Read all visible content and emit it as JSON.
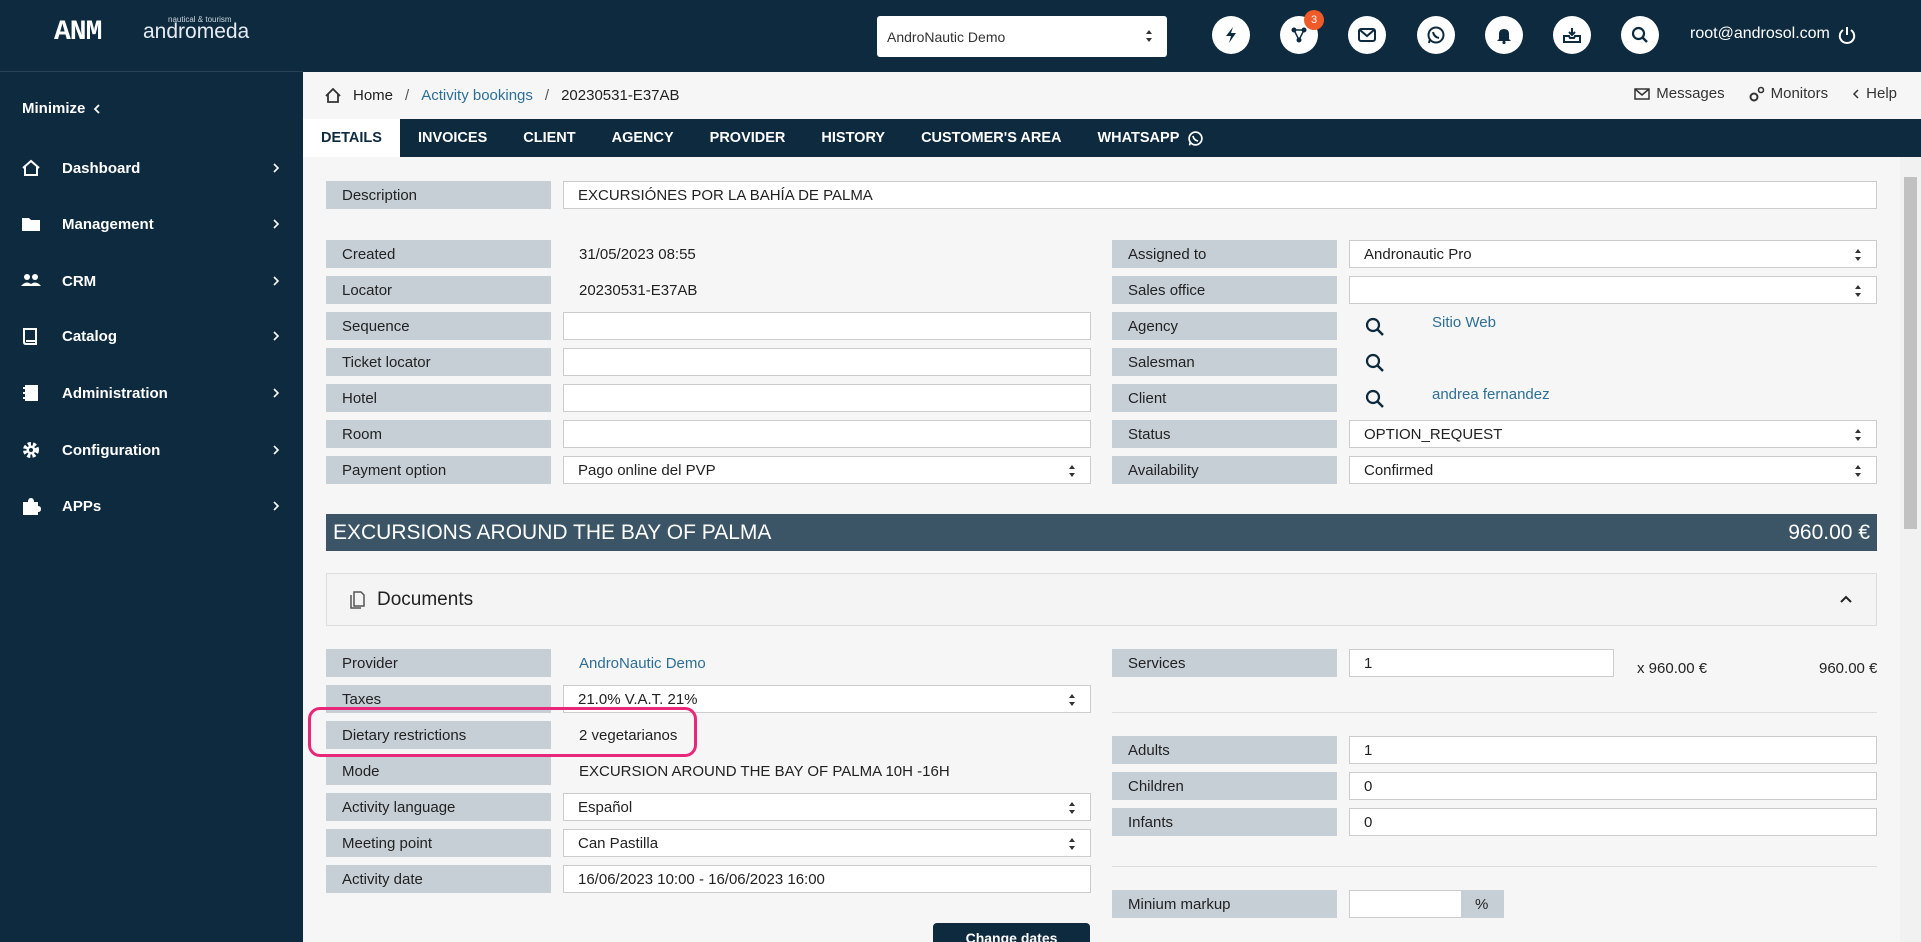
{
  "app": {
    "logo_mark": "ANM",
    "logo_tagline": "nautical & tourism",
    "logo_brand": "andromeda"
  },
  "sidebar": {
    "minimize_label": "Minimize",
    "items": [
      {
        "label": "Dashboard",
        "icon": "home-icon"
      },
      {
        "label": "Management",
        "icon": "folder-icon"
      },
      {
        "label": "CRM",
        "icon": "users-icon"
      },
      {
        "label": "Catalog",
        "icon": "book-icon"
      },
      {
        "label": "Administration",
        "icon": "ledger-icon"
      },
      {
        "label": "Configuration",
        "icon": "gear-icon"
      },
      {
        "label": "APPs",
        "icon": "puzzle-icon"
      }
    ]
  },
  "topbar": {
    "company": "AndroNautic Demo",
    "notification_count": "3",
    "user_email": "root@androsol.com"
  },
  "breadcrumb": {
    "home": "Home",
    "section": "Activity bookings",
    "current": "20230531-E37AB"
  },
  "header_links": {
    "messages": "Messages",
    "monitors": "Monitors",
    "help": "Help"
  },
  "tabs": [
    "DETAILS",
    "INVOICES",
    "CLIENT",
    "AGENCY",
    "PROVIDER",
    "HISTORY",
    "CUSTOMER'S AREA",
    "WHATSAPP"
  ],
  "form": {
    "description_label": "Description",
    "description": "EXCURSIÓNES POR LA BAHÍA DE PALMA",
    "created_label": "Created",
    "created": "31/05/2023 08:55",
    "locator_label": "Locator",
    "locator": "20230531-E37AB",
    "sequence_label": "Sequence",
    "sequence": "",
    "ticket_locator_label": "Ticket locator",
    "ticket_locator": "",
    "hotel_label": "Hotel",
    "hotel": "",
    "room_label": "Room",
    "room": "",
    "payment_option_label": "Payment option",
    "payment_option": "Pago online del PVP",
    "assigned_to_label": "Assigned to",
    "assigned_to": "Andronautic Pro",
    "sales_office_label": "Sales office",
    "sales_office": "",
    "agency_label": "Agency",
    "agency": "Sitio Web",
    "salesman_label": "Salesman",
    "salesman": "",
    "client_label": "Client",
    "client": "andrea fernandez",
    "status_label": "Status",
    "status": "OPTION_REQUEST",
    "availability_label": "Availability",
    "availability": "Confirmed"
  },
  "activity": {
    "title": "EXCURSIONS AROUND THE BAY OF PALMA",
    "price": "960.00 €",
    "documents_label": "Documents",
    "provider_label": "Provider",
    "provider": "AndroNautic Demo",
    "taxes_label": "Taxes",
    "taxes": "21.0% V.A.T. 21%",
    "dietary_label": "Dietary restrictions",
    "dietary": "2 vegetarianos",
    "mode_label": "Mode",
    "mode": "EXCURSION AROUND THE BAY OF PALMA 10H -16H",
    "language_label": "Activity language",
    "language": "Español",
    "meeting_point_label": "Meeting point",
    "meeting_point": "Can Pastilla",
    "activity_date_label": "Activity date",
    "activity_date": "16/06/2023 10:00 - 16/06/2023 16:00",
    "change_dates_label": "Change dates",
    "services_label": "Services",
    "services": "1",
    "unit_price": "x 960.00 €",
    "services_total": "960.00 €",
    "adults_label": "Adults",
    "adults": "1",
    "children_label": "Children",
    "children": "0",
    "infants_label": "Infants",
    "infants": "0",
    "min_markup_label": "Minium markup",
    "min_markup": "",
    "min_markup_unit": "%"
  },
  "colors": {
    "navy": "#0e2a3f",
    "label_bg": "#c7cfd6",
    "link": "#2e6f96",
    "badge": "#f05a28",
    "highlight": "#e8277a"
  }
}
